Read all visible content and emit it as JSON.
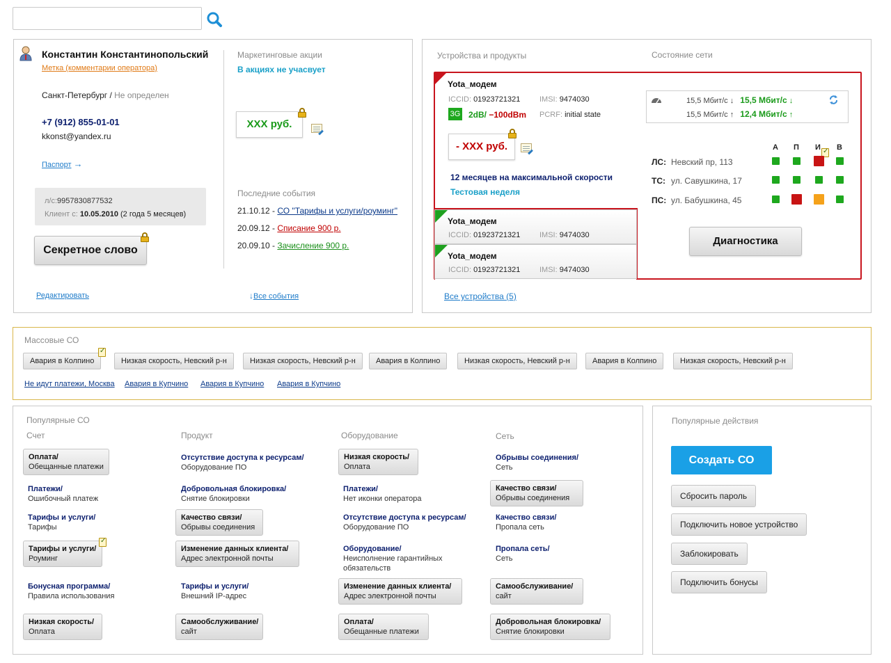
{
  "search": {
    "placeholder": "",
    "value": ""
  },
  "customer": {
    "name": "Константин Константинопольский",
    "operator_note": "Метка (комментарии оператора)",
    "city": "Санкт-Петербург",
    "city_sep": " / ",
    "region": "Не определен",
    "phone": "+7 (912) 855-01-01",
    "email": "kkonst@yandex.ru",
    "passport_link": "Паспорт",
    "account_label": "л/с:",
    "account_number": "9957830877532",
    "client_since_label": "Клиент с:",
    "client_since_date": "10.05.2010",
    "client_since_duration": "(2 года 5 месяцев)",
    "secret_word_button": "Секретное слово",
    "edit_link": "Редактировать"
  },
  "marketing": {
    "title": "Маркетинговые акции",
    "status": "В акциях не учасвует",
    "price": "XXX руб."
  },
  "events": {
    "title": "Последние события",
    "items": [
      {
        "date": "21.10.12",
        "sep": " - ",
        "text": "СО \"Тарифы и услуги/роуминг\""
      },
      {
        "date": "20.09.12",
        "sep": " - ",
        "text": "Списание 900 р."
      },
      {
        "date": "20.09.10",
        "sep": " - ",
        "text": "Зачисление 900 р."
      }
    ],
    "all_link": "Все события"
  },
  "devices": {
    "title": "Устройства и продукты",
    "network_title": "Состояние сети",
    "active": {
      "name": "Yota_модем",
      "iccid_label": "ICCID:",
      "iccid": "01923721321",
      "imsi_label": "IMSI:",
      "imsi": "9474030",
      "net_badge": "3G",
      "signal": "2dB/",
      "rssi": "−100dBm",
      "pcrf_label": "PCRF:",
      "pcrf": "initial state",
      "price": "- XXX руб.",
      "plan": "12 месяцев на максимальной скорости",
      "trial": "Тестовая неделя"
    },
    "others": [
      {
        "name": "Yota_модем",
        "iccid_label": "ICCID:",
        "iccid": "01923721321",
        "imsi_label": "IMSI:",
        "imsi": "9474030"
      },
      {
        "name": "Yota_модем",
        "iccid_label": "ICCID:",
        "iccid": "01923721321",
        "imsi_label": "IMSI:",
        "imsi": "9474030"
      }
    ],
    "all_link": "Все устройства (5)"
  },
  "speed": {
    "down_plan": "15,5 Мбит/с",
    "down_actual": "15,5 Мбит/с",
    "up_plan": "15,5 Мбит/с",
    "up_actual": "12,4 Мбит/с"
  },
  "network": {
    "columns": [
      "А",
      "П",
      "И",
      "В"
    ],
    "rows": [
      {
        "label": "ЛС:",
        "address": "Невский пр, 113",
        "states": [
          "green",
          "green",
          "red",
          "green"
        ]
      },
      {
        "label": "ТС:",
        "address": "ул. Савушкина, 17",
        "states": [
          "green",
          "green",
          "green",
          "green"
        ]
      },
      {
        "label": "ПС:",
        "address": "ул. Бабушкина, 45",
        "states": [
          "green",
          "red",
          "orange",
          "green"
        ]
      }
    ],
    "diagnostics_button": "Диагностика",
    "colors": {
      "green": "#1ea81e",
      "red": "#c81414",
      "orange": "#f5a21b",
      "accent_red": "#c8141d"
    }
  },
  "mass": {
    "title": "Массовые СО",
    "chips": [
      "Авария в Колпино",
      "Низкая скорость, Невский р-н",
      "Низкая скорость, Невский р-н",
      "Авария в Колпино",
      "Низкая скорость, Невский р-н",
      "Авария в Колпино",
      "Низкая скорость, Невский р-н"
    ],
    "links": [
      "Не идут платежи, Москва",
      "Авария в Купчино",
      "Авария в Купчино",
      "Авария в Купчино"
    ]
  },
  "popular": {
    "title": "Популярные СО",
    "columns": [
      "Счет",
      "Продукт",
      "Оборудование",
      "Сеть"
    ],
    "col1": [
      {
        "head": "Оплата/",
        "sub": "Обещанные платежи"
      },
      {
        "head": "Платежи/",
        "sub": "Ошибочный платеж"
      },
      {
        "head": "Тарифы и услуги/",
        "sub": "Тарифы"
      },
      {
        "head": "Тарифы и услуги/",
        "sub": "Роуминг"
      },
      {
        "head": "Бонусная программа/",
        "sub": "Правила использования"
      },
      {
        "head": "Низкая скорость/",
        "sub": "Оплата"
      }
    ],
    "col2": [
      {
        "head": "Отсутствие доступа к ресурсам/",
        "sub": "Оборудование ПО"
      },
      {
        "head": "Добровольная блокировка/",
        "sub": "Снятие блокировки"
      },
      {
        "head": "Качество связи/",
        "sub": "Обрывы соединения"
      },
      {
        "head": "Изменение данных клиента/",
        "sub": "Адрес электронной почты"
      },
      {
        "head": "Тарифы и услуги/",
        "sub": "Внешний IP-адрес"
      },
      {
        "head": "Самообслуживание/",
        "sub": "сайт"
      }
    ],
    "col3": [
      {
        "head": "Низкая скорость/",
        "sub": "Оплата"
      },
      {
        "head": "Платежи/",
        "sub": "Нет иконки оператора"
      },
      {
        "head": "Отсутствие доступа к ресурсам/",
        "sub": "Оборудование ПО"
      },
      {
        "head": "Оборудование/",
        "sub": "Неисполнение гарантийных",
        "sub2": "обязательств"
      },
      {
        "head": "Изменение данных клиента/",
        "sub": "Адрес электронной почты"
      },
      {
        "head": "Оплата/",
        "sub": "Обещанные платежи"
      }
    ],
    "col4": [
      {
        "head": "Обрывы соединения/",
        "sub": "Сеть"
      },
      {
        "head": "Качество связи/",
        "sub": "Обрывы соединения"
      },
      {
        "head": "Качество связи/",
        "sub": "Пропала сеть"
      },
      {
        "head": "Пропала сеть/",
        "sub": "Сеть"
      },
      {
        "head": "Самообслуживание/",
        "sub": "сайт"
      },
      {
        "head": "Добровольная блокировка/",
        "sub": "Снятие блокировки"
      }
    ]
  },
  "actions": {
    "title": "Популярные действия",
    "primary": "Создать СО",
    "items": [
      "Сбросить пароль",
      "Подключить новое устройство",
      "Заблокировать",
      "Подключить бонусы"
    ],
    "primary_color": "#1aa0e6"
  }
}
